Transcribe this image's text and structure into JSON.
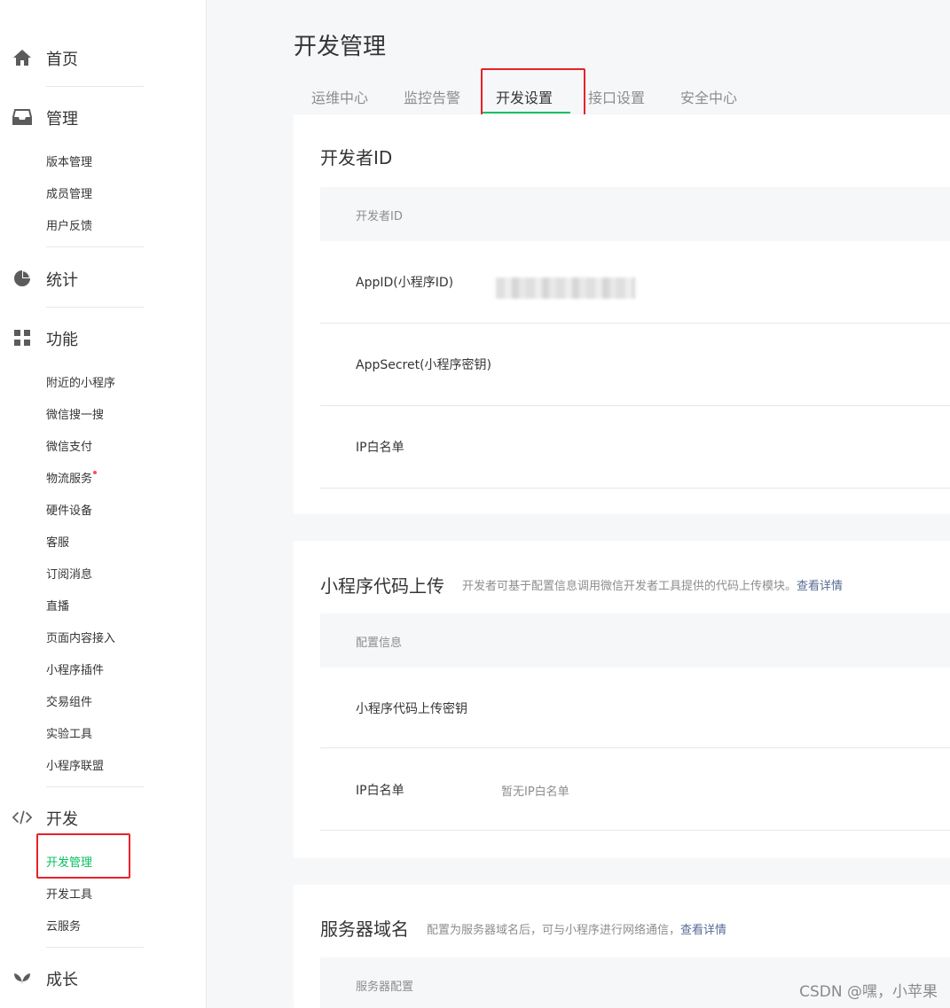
{
  "sidebar": {
    "home": {
      "label": "首页",
      "icon": "home-icon"
    },
    "manage": {
      "label": "管理",
      "icon": "inbox-icon",
      "items": [
        "版本管理",
        "成员管理",
        "用户反馈"
      ]
    },
    "stats": {
      "label": "统计",
      "icon": "pie-chart-icon"
    },
    "features": {
      "label": "功能",
      "icon": "grid-icon",
      "items": [
        "附近的小程序",
        "微信搜一搜",
        "微信支付",
        "物流服务",
        "硬件设备",
        "客服",
        "订阅消息",
        "直播",
        "页面内容接入",
        "小程序插件",
        "交易组件",
        "实验工具",
        "小程序联盟"
      ]
    },
    "develop": {
      "label": "开发",
      "icon": "code-icon",
      "items": [
        "开发管理",
        "开发工具",
        "云服务"
      ],
      "active_item": "开发管理"
    },
    "growth": {
      "label": "成长",
      "icon": "sprout-icon"
    }
  },
  "main": {
    "title": "开发管理",
    "tabs": [
      "运维中心",
      "监控告警",
      "开发设置",
      "接口设置",
      "安全中心"
    ],
    "active_tab": "开发设置",
    "developer_id": {
      "title": "开发者ID",
      "table_header": "开发者ID",
      "rows": [
        {
          "key": "AppID(小程序ID)",
          "value": ""
        },
        {
          "key": "AppSecret(小程序密钥)",
          "value": ""
        },
        {
          "key": "IP白名单",
          "value": ""
        }
      ]
    },
    "code_upload": {
      "title": "小程序代码上传",
      "desc": "开发者可基于配置信息调用微信开发者工具提供的代码上传模块。",
      "link": "查看详情",
      "table_header": "配置信息",
      "rows": [
        {
          "key": "小程序代码上传密钥",
          "value": ""
        },
        {
          "key": "IP白名单",
          "value": "暂无IP白名单"
        }
      ]
    },
    "server_domain": {
      "title": "服务器域名",
      "desc": "配置为服务器域名后，可与小程序进行网络通信，",
      "link": "查看详情",
      "table_header": "服务器配置"
    }
  },
  "watermark": "CSDN @嘿，小苹果",
  "colors": {
    "accent": "#07c160",
    "highlight": "#e8212b",
    "link": "#576b95",
    "notice_dot": "#fa5151"
  }
}
